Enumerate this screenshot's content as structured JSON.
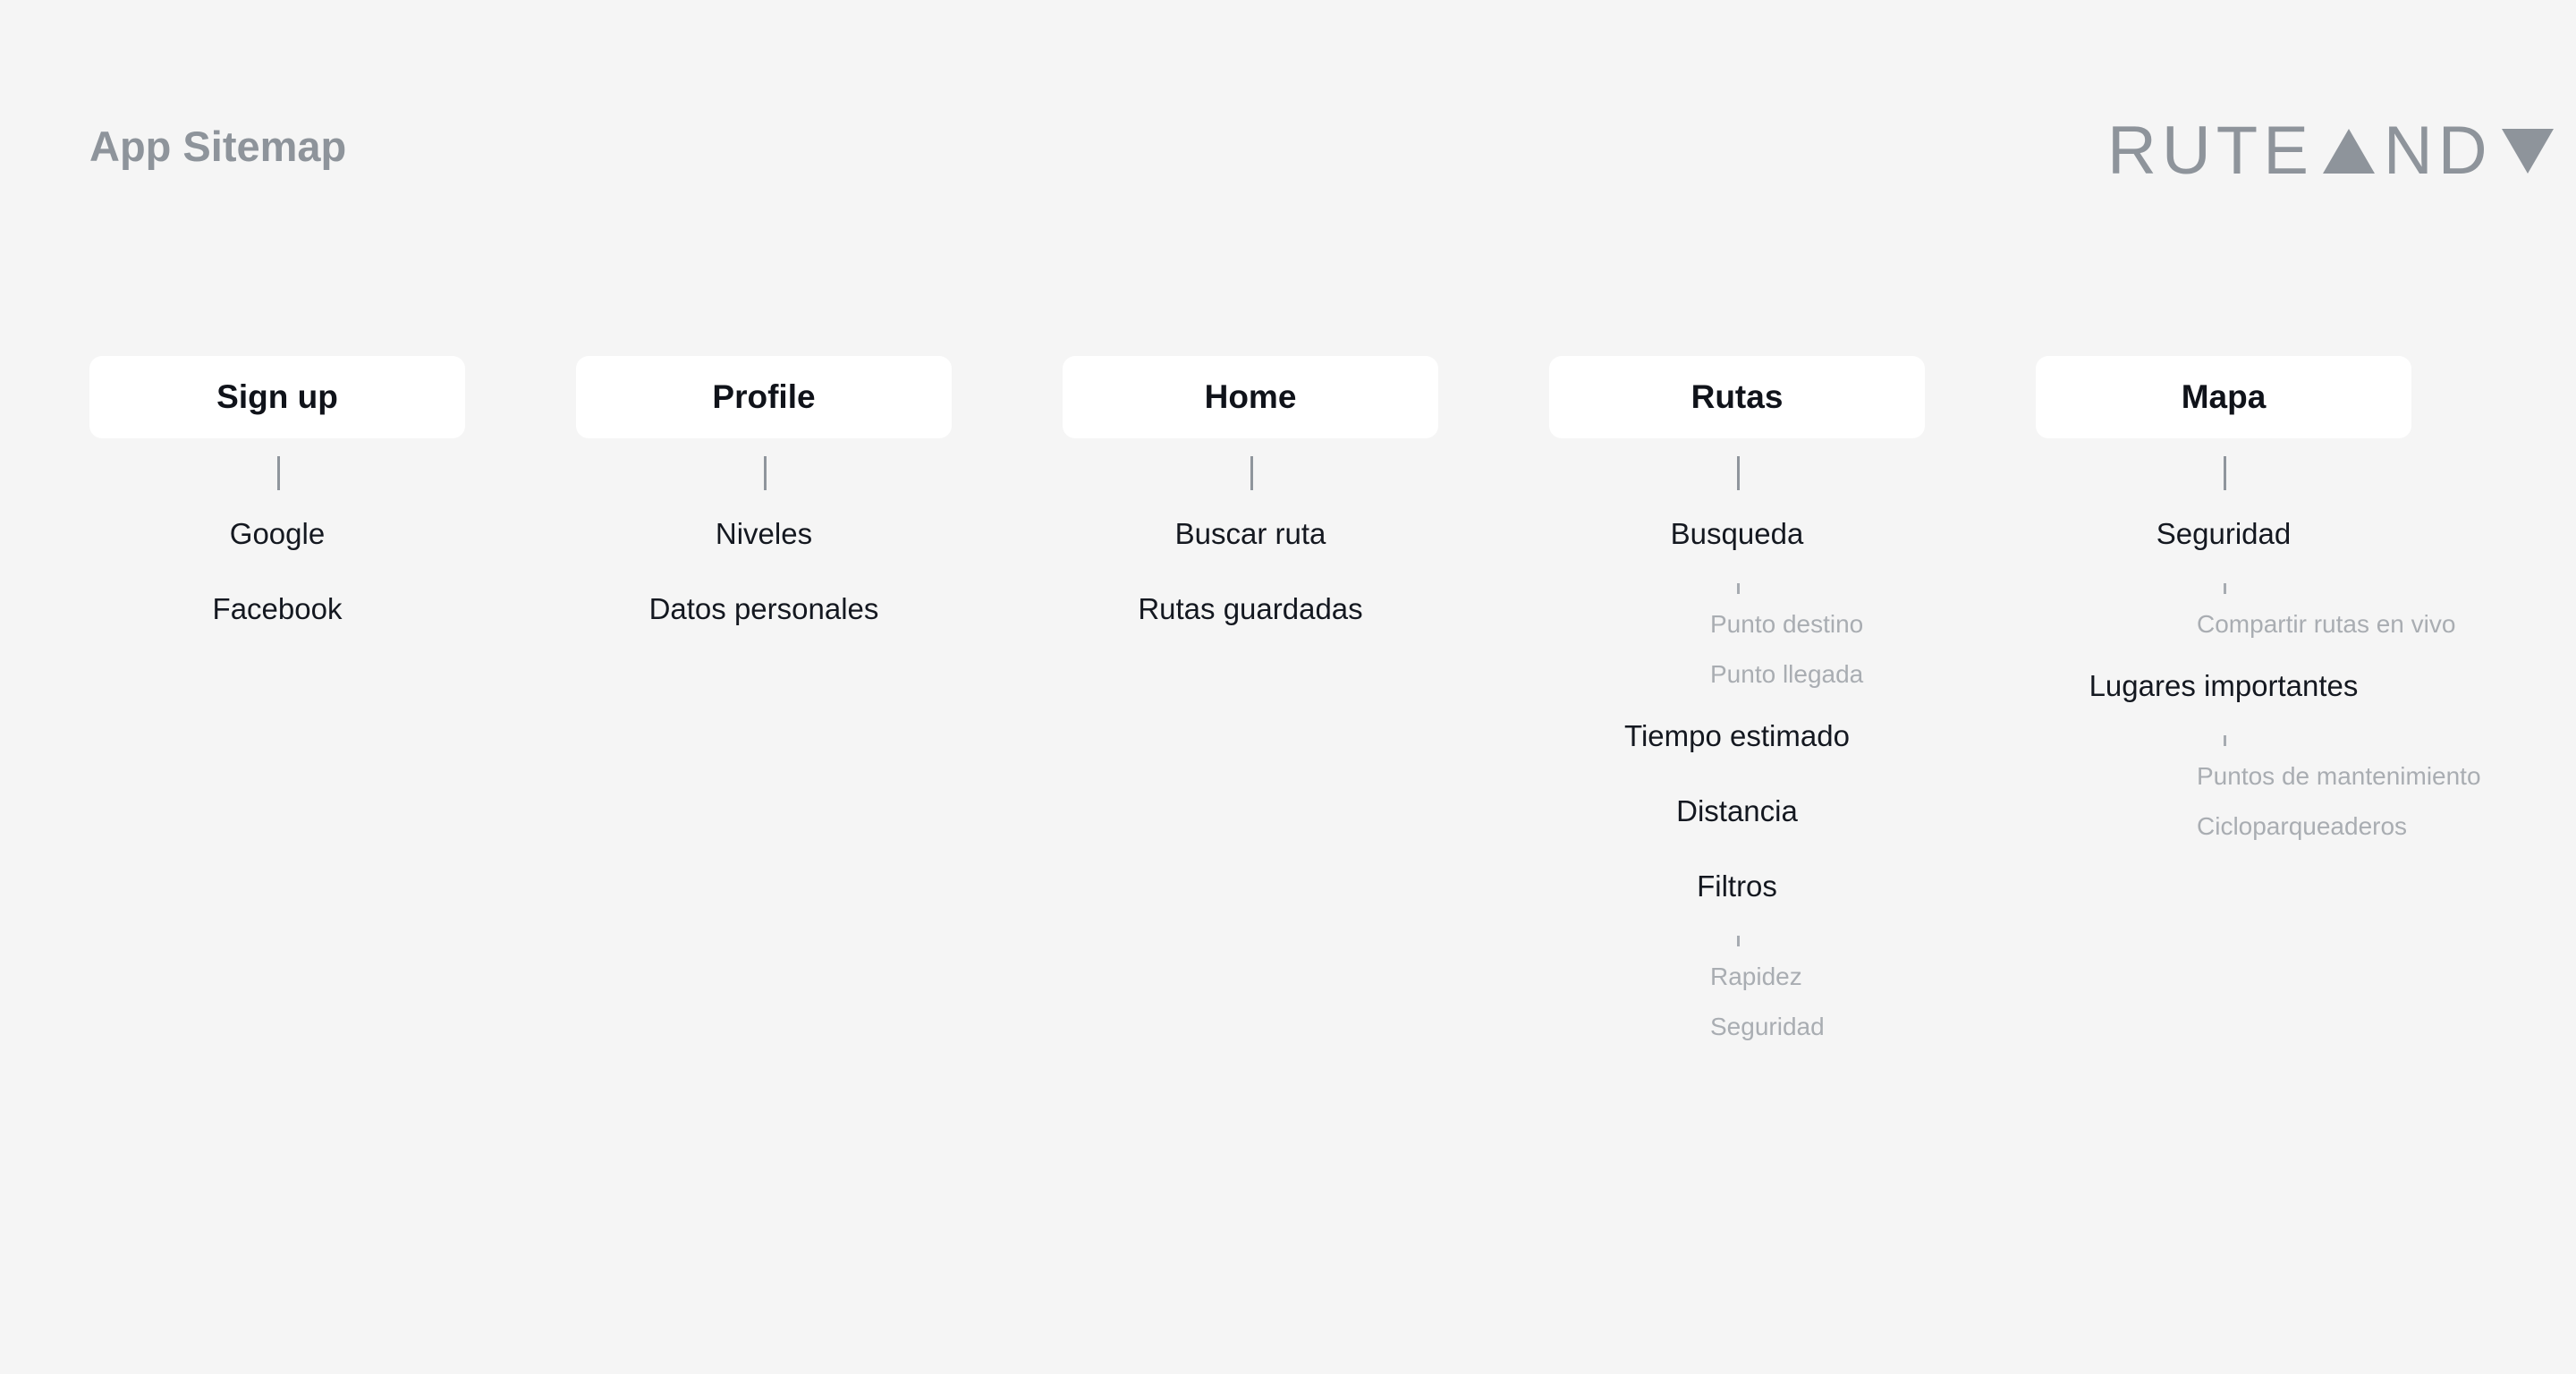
{
  "header": {
    "title": "App Sitemap",
    "logo_text_left": "RUTE",
    "logo_text_mid": "ND",
    "logo_icons": [
      "triangle-up-icon",
      "triangle-down-icon"
    ]
  },
  "colors": {
    "background": "#f5f5f5",
    "card": "#ffffff",
    "title": "#8e949b",
    "primary_text": "#141820",
    "secondary_text": "#a9adb2",
    "connector": "#8f959c"
  },
  "columns": [
    {
      "title": "Sign up",
      "items": [
        "Google",
        "Facebook"
      ]
    },
    {
      "title": "Profile",
      "items": [
        "Niveles",
        "Datos personales"
      ]
    },
    {
      "title": "Home",
      "items": [
        "Buscar ruta",
        "Rutas guardadas"
      ]
    },
    {
      "title": "Rutas",
      "items": [
        "Busqueda",
        "Tiempo estimado",
        "Distancia",
        "Filtros"
      ],
      "busqueda_sub": [
        "Punto destino",
        "Punto llegada"
      ],
      "filtros_sub": [
        "Rapidez",
        "Seguridad"
      ]
    },
    {
      "title": "Mapa",
      "items": [
        "Seguridad",
        "Lugares importantes"
      ],
      "seguridad_sub": [
        "Compartir rutas en vivo"
      ],
      "lugares_sub": [
        "Puntos de mantenimiento",
        "Cicloparqueaderos"
      ]
    }
  ]
}
